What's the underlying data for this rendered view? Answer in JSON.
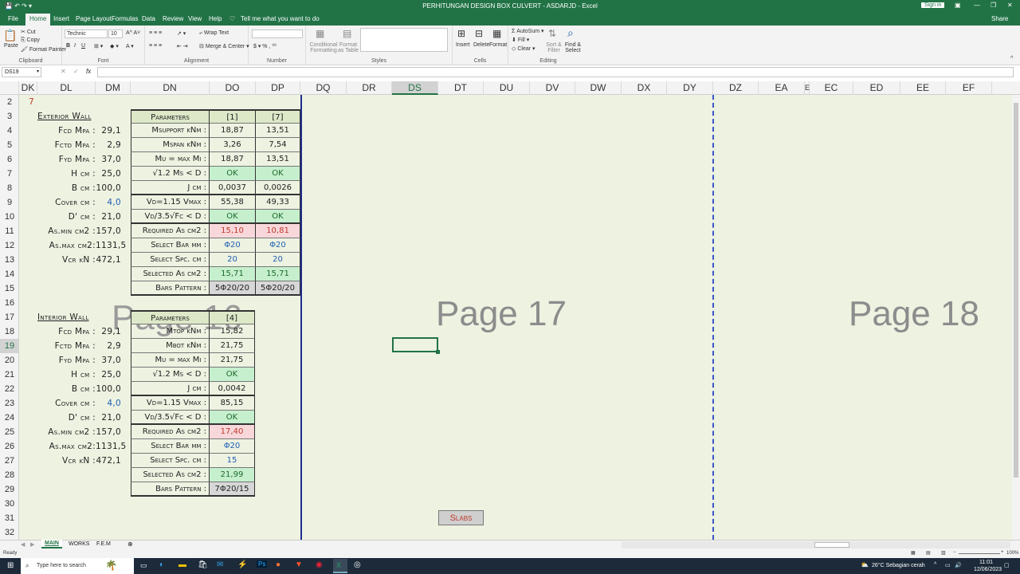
{
  "window": {
    "title": "PERHITUNGAN DESIGN BOX CULVERT - ASDARJD - Excel",
    "signin": "Sign in"
  },
  "tabs": [
    "File",
    "Home",
    "Insert",
    "Page Layout",
    "Formulas",
    "Data",
    "Review",
    "View",
    "Help",
    "Tell me what you want to do"
  ],
  "ribbon": {
    "clipboard": {
      "paste": "Paste",
      "cut": "Cut",
      "copy": "Copy",
      "format_painter": "Format Painter",
      "label": "Clipboard"
    },
    "font": {
      "name": "Technic",
      "size": "10",
      "label": "Font"
    },
    "alignment": {
      "wrap": "Wrap Text",
      "merge": "Merge & Center",
      "label": "Alignment"
    },
    "number": {
      "label": "Number"
    },
    "styles": {
      "cond": "Conditional Formatting",
      "fmt_table": "Format as Table",
      "label": "Styles"
    },
    "cells": {
      "insert": "Insert",
      "delete": "Delete",
      "format": "Format",
      "label": "Cells"
    },
    "editing": {
      "autosum": "AutoSum",
      "fill": "Fill",
      "clear": "Clear",
      "sort": "Sort & Filter",
      "find": "Find & Select",
      "label": "Editing"
    },
    "share": "Share"
  },
  "formula": {
    "namebox": "DS19",
    "fx": "fx"
  },
  "columns": [
    "DK",
    "DL",
    "DM",
    "DN",
    "DO",
    "DP",
    "DQ",
    "DR",
    "DS",
    "DT",
    "DU",
    "DV",
    "DW",
    "DX",
    "DY",
    "DZ",
    "EA",
    "E",
    "EC",
    "ED",
    "EE",
    "EF"
  ],
  "rows": [
    "2",
    "3",
    "4",
    "5",
    "6",
    "7",
    "8",
    "9",
    "10",
    "11",
    "12",
    "13",
    "14",
    "15",
    "16",
    "17",
    "18",
    "19",
    "20",
    "21",
    "22",
    "23",
    "24",
    "25",
    "26",
    "27",
    "28",
    "29",
    "30",
    "31",
    "32"
  ],
  "cell_dk2": "7",
  "exterior": {
    "title": "Exterior Wall",
    "left": [
      {
        "label": "Fcd Mpa :",
        "value": "29,1"
      },
      {
        "label": "Fctd Mpa :",
        "value": "2,9"
      },
      {
        "label": "Fyd Mpa :",
        "value": "37,0"
      },
      {
        "label": "H cm :",
        "value": "25,0"
      },
      {
        "label": "B cm :",
        "value": "100,0"
      },
      {
        "label": "Cover cm :",
        "value": "4,0"
      },
      {
        "label": "D' cm :",
        "value": "21,0"
      },
      {
        "label": "As.min cm2 :",
        "value": "157,0"
      },
      {
        "label": "As.max cm2:",
        "value": "1131,5"
      },
      {
        "label": "Vcr kN :",
        "value": "472,1"
      }
    ],
    "header": [
      "Parameters",
      "[1]",
      "[7]"
    ],
    "rows": [
      {
        "p": "Msupport kNm :",
        "a": "18,87",
        "b": "13,51",
        "s": ""
      },
      {
        "p": "Mspan kNm :",
        "a": "3,26",
        "b": "7,54",
        "s": ""
      },
      {
        "p": "Mu = max Mi :",
        "a": "18,87",
        "b": "13,51",
        "s": ""
      },
      {
        "p": "√1.2 Ms < D :",
        "a": "OK",
        "b": "OK",
        "s": "ok"
      },
      {
        "p": "J cm :",
        "a": "0,0037",
        "b": "0,0026",
        "s": ""
      },
      {
        "p": "Vd=1.15 Vmax :",
        "a": "55,38",
        "b": "49,33",
        "s": ""
      },
      {
        "p": "Vd/3.5√Fc < D :",
        "a": "OK",
        "b": "OK",
        "s": "ok"
      },
      {
        "p": "Required As cm2 :",
        "a": "15,10",
        "b": "10,81",
        "s": "red"
      },
      {
        "p": "Select Bar mm :",
        "a": "Φ20",
        "b": "Φ20",
        "s": "blue"
      },
      {
        "p": "Select Spc. cm :",
        "a": "20",
        "b": "20",
        "s": "blue"
      },
      {
        "p": "Selected As cm2 :",
        "a": "15,71",
        "b": "15,71",
        "s": "ok"
      },
      {
        "p": "Bars Pattern :",
        "a": "5Φ20/20",
        "b": "5Φ20/20",
        "s": "grey"
      }
    ]
  },
  "interior": {
    "title": "Interior Wall",
    "left": [
      {
        "label": "Fcd Mpa :",
        "value": "29,1"
      },
      {
        "label": "Fctd Mpa :",
        "value": "2,9"
      },
      {
        "label": "Fyd Mpa :",
        "value": "37,0"
      },
      {
        "label": "H cm :",
        "value": "25,0"
      },
      {
        "label": "B cm :",
        "value": "100,0"
      },
      {
        "label": "Cover cm :",
        "value": "4,0"
      },
      {
        "label": "D' cm :",
        "value": "21,0"
      },
      {
        "label": "As.min cm2 :",
        "value": "157,0"
      },
      {
        "label": "As.max cm2:",
        "value": "1131,5"
      },
      {
        "label": "Vcr kN :",
        "value": "472,1"
      }
    ],
    "header": [
      "Parameters",
      "[4]"
    ],
    "rows": [
      {
        "p": "Mtop kNm :",
        "a": "15,82",
        "s": ""
      },
      {
        "p": "Mbot kNm :",
        "a": "21,75",
        "s": ""
      },
      {
        "p": "Mu = max Mi :",
        "a": "21,75",
        "s": ""
      },
      {
        "p": "√1.2 Ms < D :",
        "a": "OK",
        "s": "ok"
      },
      {
        "p": "J cm :",
        "a": "0,0042",
        "s": ""
      },
      {
        "p": "Vd=1.15 Vmax :",
        "a": "85,15",
        "s": ""
      },
      {
        "p": "Vd/3.5√Fc < D :",
        "a": "OK",
        "s": "ok"
      },
      {
        "p": "Required As cm2 :",
        "a": "17,40",
        "s": "red"
      },
      {
        "p": "Select Bar mm :",
        "a": "Φ20",
        "s": "blue"
      },
      {
        "p": "Select Spc. cm :",
        "a": "15",
        "s": "blue"
      },
      {
        "p": "Selected As cm2 :",
        "a": "21,99",
        "s": "ok"
      },
      {
        "p": "Bars Pattern :",
        "a": "7Φ20/15",
        "s": "grey"
      }
    ]
  },
  "pages": {
    "p16": "Page 16",
    "p17": "Page 17",
    "p18": "Page 18"
  },
  "slabs_button": "Slabs",
  "sheets": [
    "MAIN",
    "WORKS",
    "F.E.M"
  ],
  "status": {
    "ready": "Ready",
    "zoom": "100%"
  },
  "taskbar": {
    "search": "Type here to search",
    "weather": "26°C  Sebagian cerah",
    "time": "11:01",
    "date": "12/06/2023"
  }
}
